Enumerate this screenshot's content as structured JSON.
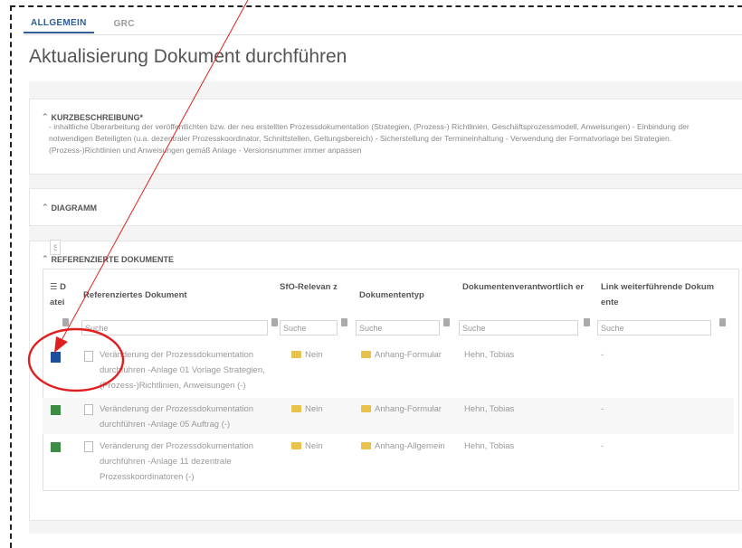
{
  "tabs": {
    "general": "ALLGEMEIN",
    "grc": "GRC"
  },
  "page_title": "Aktualisierung Dokument durchführen",
  "sections": {
    "short_desc": {
      "title": "KURZBESCHREIBUNG*",
      "text": "- inhaltliche Überarbeitung der veröffentlichten bzw. der neu erstellten Prozessdokumentation (Strategien, (Prozess-) Richtlinien, Geschäftsprozessmodell, Anweisungen) - Einbindung der notwendigen Beteiligten (u.a. dezentraler Prozesskoordinator, Schnittstellen, Geltungsbereich) - Sicherstellung der Termineinhaltung - Verwendung der Formatvorlage bei Strategien. (Prozess-)Richtlinien und Anweisungen gemäß Anlage - Versionsnummer immer anpassen"
    },
    "diagram": {
      "title": "DIAGRAMM"
    },
    "refs": {
      "title": "REFERENZIERTE DOKUMENTE"
    }
  },
  "table": {
    "headers": {
      "file": "D atei",
      "ref": "Referenziertes Dokument",
      "sfo": "SfO-Relevan z",
      "type": "Dokumententyp",
      "owner": "Dokumentenverantwortlich er",
      "link": "Link weiterführende Dokum ente"
    },
    "filter_placeholder": "Suche",
    "rows": [
      {
        "doc": "Veränderung der Prozessdokumentation durchführen -Anlage 01 Vorlage Strategien, (Prozess-)Richtlinien, Anweisungen (-)",
        "sfo": "Nein",
        "type": "Anhang-Formular",
        "owner": "Hehn, Tobias",
        "link": "-"
      },
      {
        "doc": "Veränderung der Prozessdokumentation durchführen -Anlage 05 Auftrag (-)",
        "sfo": "Nein",
        "type": "Anhang-Formular",
        "owner": "Hehn, Tobias",
        "link": "-"
      },
      {
        "doc": "Veränderung der Prozessdokumentation durchführen -Anlage 11 dezentrale Prozesskoordinatoren (-)",
        "sfo": "Nein",
        "type": "Anhang-Allgemein",
        "owner": "Hehn, Tobias",
        "link": "-"
      }
    ]
  },
  "colors": {
    "accent": "#2f5d97",
    "annotation": "#e02020"
  }
}
